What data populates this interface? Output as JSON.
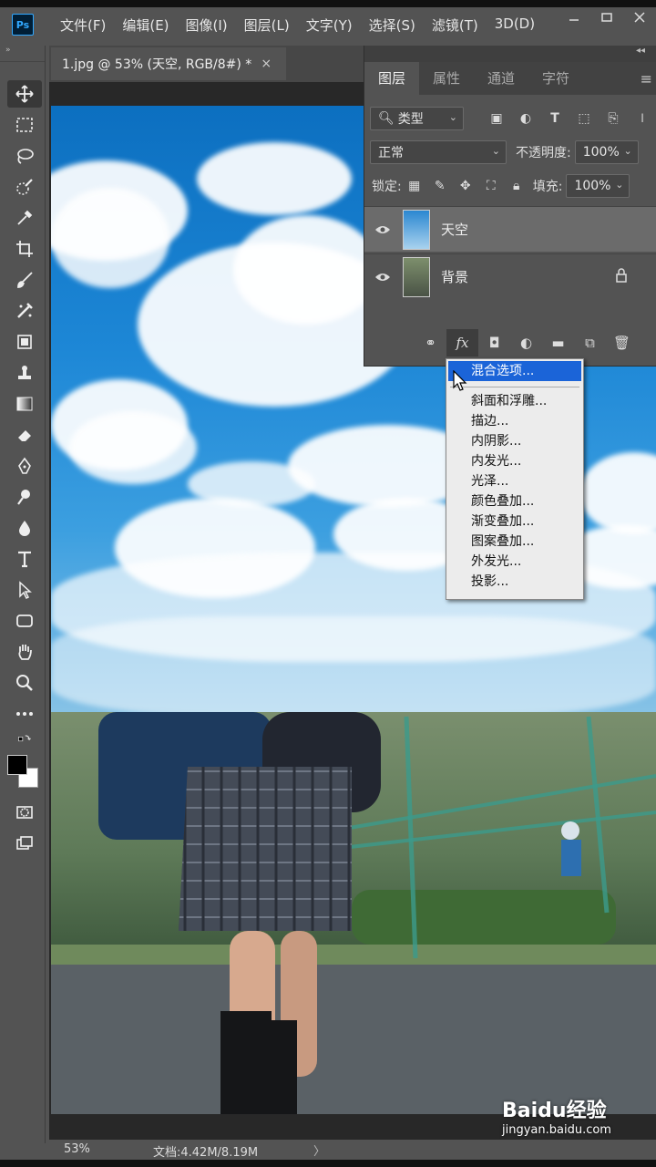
{
  "app": {
    "logo": "Ps"
  },
  "menu": [
    "文件(F)",
    "编辑(E)",
    "图像(I)",
    "图层(L)",
    "文字(Y)",
    "选择(S)",
    "滤镜(T)",
    "3D(D)"
  ],
  "window_controls": [
    "minimize-icon",
    "restore-icon",
    "close-icon"
  ],
  "document_tab": {
    "title": "1.jpg @ 53% (天空, RGB/8#) *",
    "close": "×"
  },
  "toolbar": {
    "tools": [
      "move-tool-icon",
      "marquee-tool-icon",
      "lasso-tool-icon",
      "quick-select-tool-icon",
      "eyedropper-tool-icon",
      "crop-tool-icon",
      "brush-tool-icon",
      "healing-brush-icon",
      "patch-tool-icon",
      "clone-stamp-icon",
      "gradient-tool-icon",
      "eraser-tool-icon",
      "pen-tool-icon",
      "dodge-tool-icon",
      "blur-drop-icon",
      "type-tool-icon",
      "path-select-icon",
      "shape-tool-icon",
      "hand-tool-icon",
      "zoom-tool-icon",
      "more-tools-icon"
    ],
    "foreground_color": "#000000",
    "background_color": "#ffffff"
  },
  "layers_panel": {
    "tabs": [
      "图层",
      "属性",
      "通道",
      "字符"
    ],
    "active_tab": "图层",
    "filter_kind": "类型",
    "blend_mode": "正常",
    "opacity_label": "不透明度:",
    "opacity_value": "100%",
    "lock_label": "锁定:",
    "fill_label": "填充:",
    "fill_value": "100%",
    "layers": [
      {
        "name": "天空",
        "visible": true,
        "selected": true,
        "locked": false
      },
      {
        "name": "背景",
        "visible": true,
        "selected": false,
        "locked": true
      }
    ],
    "footer_fx": "fx"
  },
  "fx_menu": {
    "items": [
      "混合选项...",
      "斜面和浮雕...",
      "描边...",
      "内阴影...",
      "内发光...",
      "光泽...",
      "颜色叠加...",
      "渐变叠加...",
      "图案叠加...",
      "外发光...",
      "投影..."
    ],
    "highlighted": "混合选项..."
  },
  "status_bar": {
    "zoom": "53%",
    "doc_info": "文档:4.42M/8.19M",
    "arrow": "〉"
  },
  "watermark": {
    "brand": "Baidu经验",
    "url": "jingyan.baidu.com"
  }
}
